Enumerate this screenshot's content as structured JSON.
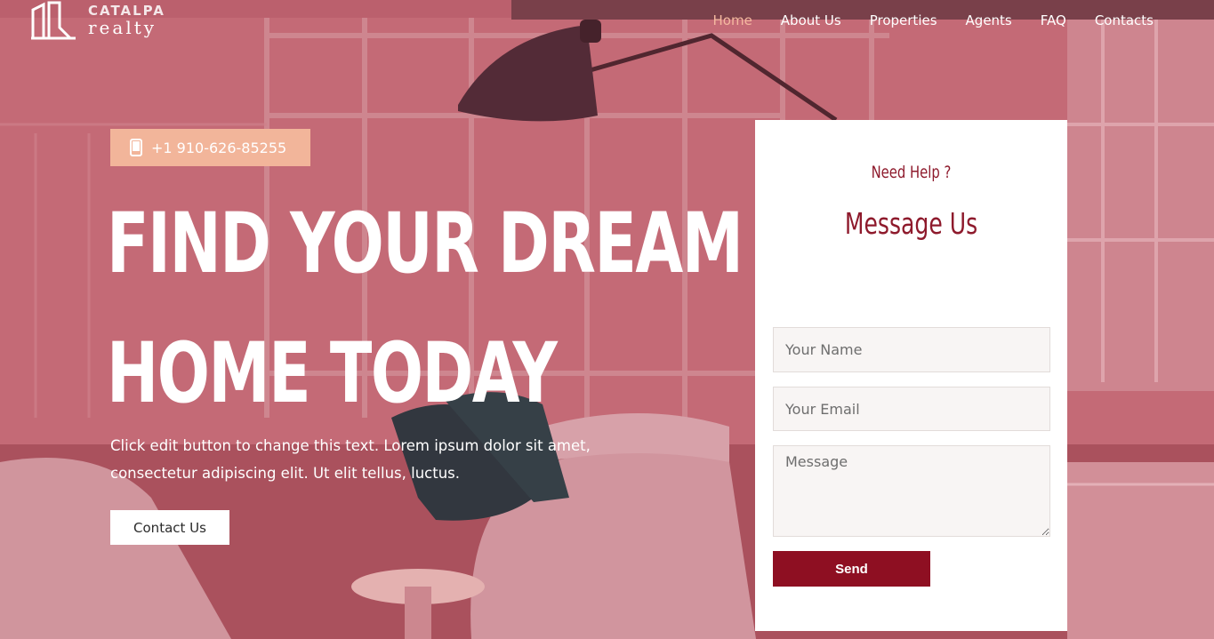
{
  "brand": {
    "name_line1": "CATALPA",
    "name_line2": "realty"
  },
  "nav": {
    "items": [
      {
        "label": "Home",
        "active": true
      },
      {
        "label": "About Us",
        "active": false
      },
      {
        "label": "Properties",
        "active": false
      },
      {
        "label": "Agents",
        "active": false
      },
      {
        "label": "FAQ",
        "active": false
      },
      {
        "label": "Contacts",
        "active": false
      }
    ]
  },
  "hero": {
    "phone": "+1 910-626-85255",
    "headline_line1": "FIND YOUR DREAM",
    "headline_line2": "HOME TODAY",
    "description": "Click edit button to change this text. Lorem ipsum dolor sit amet, consectetur adipiscing elit. Ut elit tellus, luctus.",
    "cta_label": "Contact Us"
  },
  "form": {
    "kicker": "Need Help ?",
    "title": "Message Us",
    "name_placeholder": "Your Name",
    "email_placeholder": "Your Email",
    "message_placeholder": "Message",
    "send_label": "Send"
  },
  "colors": {
    "accent": "#8e0f22",
    "peach": "#f2b59a",
    "overlay": "#b85f6a"
  },
  "icons": {
    "phone": "mobile-phone-icon",
    "logo": "building-logo-icon"
  }
}
